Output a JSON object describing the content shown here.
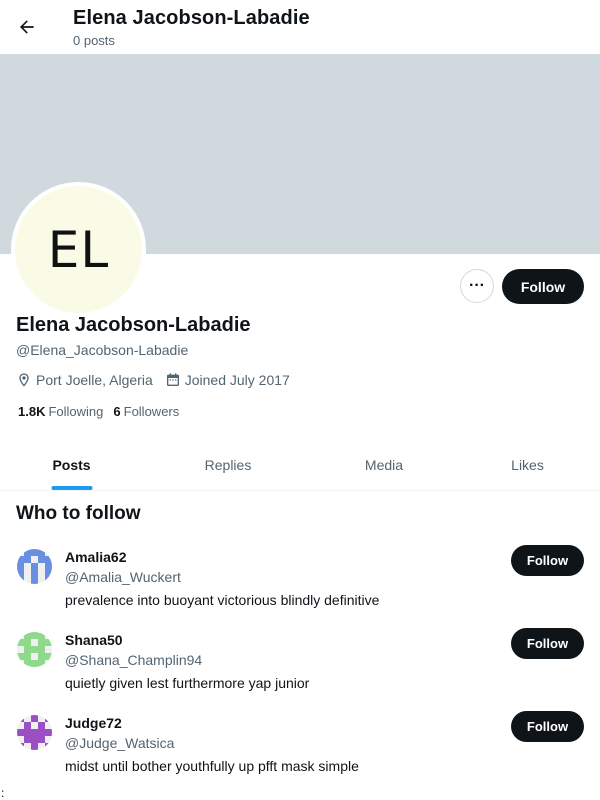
{
  "header": {
    "title": "Elena Jacobson-Labadie",
    "subtitle": "0 posts"
  },
  "profile": {
    "initials": "EL",
    "name": "Elena Jacobson-Labadie",
    "handle": "@Elena_Jacobson-Labadie",
    "location": "Port Joelle, Algeria",
    "joined": "Joined July 2017",
    "following_count": "1.8K",
    "following_label": "Following",
    "followers_count": "6",
    "followers_label": "Followers",
    "more_label": "···",
    "follow_label": "Follow"
  },
  "tabs": [
    {
      "label": "Posts",
      "active": true
    },
    {
      "label": "Replies",
      "active": false
    },
    {
      "label": "Media",
      "active": false
    },
    {
      "label": "Likes",
      "active": false
    }
  ],
  "who_to_follow": {
    "title": "Who to follow",
    "items": [
      {
        "name": "Amalia62",
        "handle": "@Amalia_Wuckert",
        "bio": "prevalence into buoyant victorious blindly definitive",
        "follow_label": "Follow",
        "avatar_color": "#6b8fe0"
      },
      {
        "name": "Shana50",
        "handle": "@Shana_Champlin94",
        "bio": "quietly given lest furthermore yap junior",
        "follow_label": "Follow",
        "avatar_color": "#8fd98a"
      },
      {
        "name": "Judge72",
        "handle": "@Judge_Watsica",
        "bio": "midst until bother youthfully up pfft mask simple",
        "follow_label": "Follow",
        "avatar_color": "#9b4fc4"
      }
    ]
  },
  "icons": {
    "back": "arrow-left-icon",
    "location": "location-pin-icon",
    "calendar": "calendar-icon",
    "more": "more-horizontal-icon"
  },
  "colors": {
    "banner": "#cfd9de",
    "avatar_bg": "#f9fbe7",
    "accent": "#1d9bf0",
    "button": "#0f1419"
  },
  "stray_text": ":"
}
